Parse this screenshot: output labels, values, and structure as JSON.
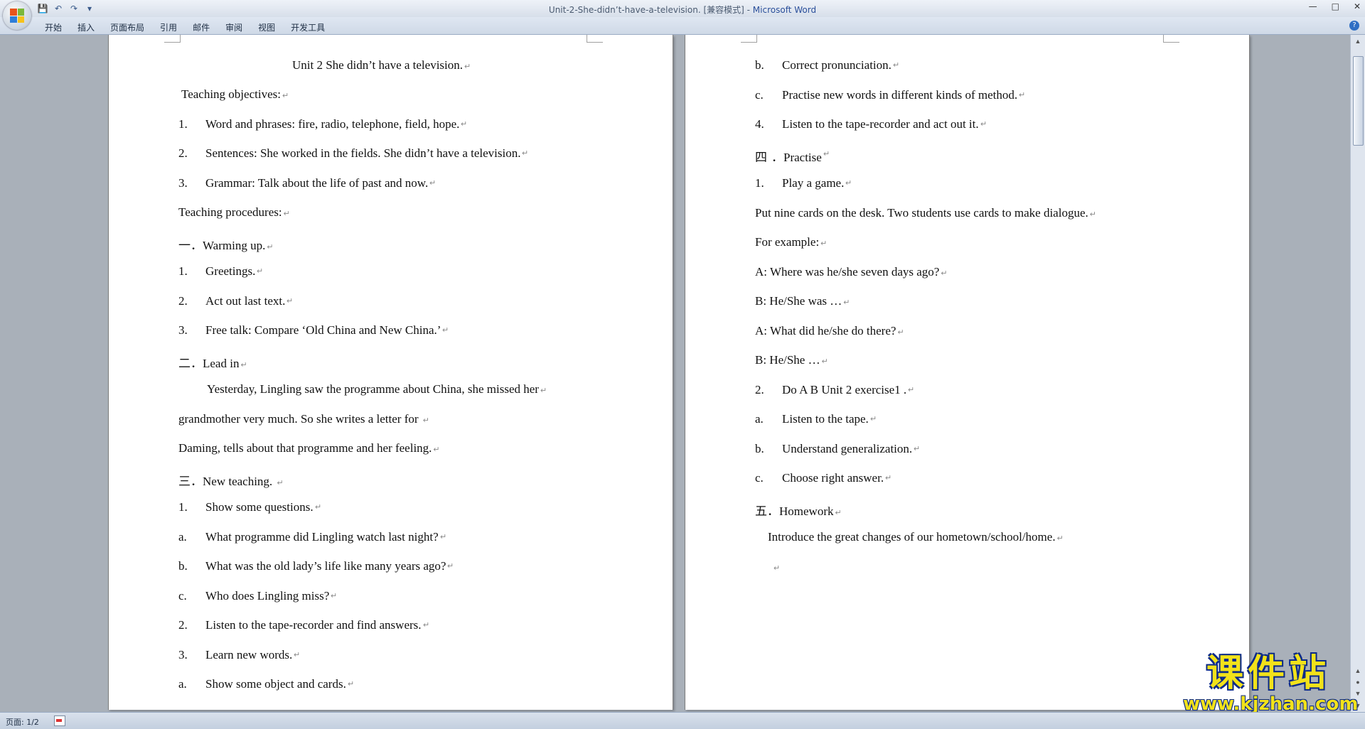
{
  "window": {
    "title": "Unit-2-She-didn’t-have-a-television. [兼容模式] - ",
    "app_name": "Microsoft Word",
    "controls": [
      "—",
      "□",
      "✕"
    ]
  },
  "quick_access": [
    "💾",
    "↶",
    "↷",
    "▾"
  ],
  "ribbon": {
    "tabs": [
      "开始",
      "插入",
      "页面布局",
      "引用",
      "邮件",
      "审阅",
      "视图",
      "开发工具"
    ],
    "help_icon": "?"
  },
  "document": {
    "left_page": {
      "title": "Unit 2 She didn’t have a television.",
      "lines": [
        {
          "text": "Teaching objectives:"
        },
        {
          "num": "1.",
          "text": "Word and phrases: fire, radio, telephone, field, hope."
        },
        {
          "num": "2.",
          "text": "Sentences: She worked in the fields. She didn’t have a television."
        },
        {
          "num": "3.",
          "text": "Grammar: Talk about the life of past and now."
        },
        {
          "text": "Teaching procedures:"
        },
        {
          "text": "一．Warming up."
        },
        {
          "num": "1.",
          "text": "Greetings."
        },
        {
          "num": "2.",
          "text": "Act out last text."
        },
        {
          "num": "3.",
          "text": "Free talk: Compare ‘Old China and New China.’"
        },
        {
          "text": "二．Lead in"
        },
        {
          "text": "Yesterday, Lingling saw the programme about China, she missed her"
        },
        {
          "text": "grandmother very much. So she writes a letter for  "
        },
        {
          "text": "Daming, tells about that programme and her feeling."
        },
        {
          "text": "三．New teaching.      "
        },
        {
          "num": "1.",
          "text": "Show some questions."
        },
        {
          "num": "a.",
          "text": "What programme did Lingling watch last night?"
        },
        {
          "num": "b.",
          "text": "What was the old lady’s life like many years ago?"
        },
        {
          "num": "c.",
          "text": "Who does Lingling miss?"
        },
        {
          "num": "2.",
          "text": "Listen to the tape-recorder and find answers."
        },
        {
          "num": "3.",
          "text": "Learn new words."
        },
        {
          "num": "a.",
          "text": "Show some object and cards."
        }
      ]
    },
    "right_page": {
      "lines": [
        {
          "num": "b.",
          "text": "Correct pronunciation."
        },
        {
          "num": "c.",
          "text": "Practise new words in different kinds of method."
        },
        {
          "num": "4.",
          "text": "Listen to the tape-recorder and act out it."
        },
        {
          "num": "四",
          "text": "．Practise"
        },
        {
          "num": "1.",
          "text": "Play a game."
        },
        {
          "text": "Put nine cards on the desk. Two students use cards to make dialogue."
        },
        {
          "text": "For example:"
        },
        {
          "text": "A: Where was he/she seven days ago?"
        },
        {
          "text": "B: He/She was …"
        },
        {
          "text": "A: What did he/she do there?"
        },
        {
          "text": "B: He/She …"
        },
        {
          "num": "2.",
          "text": "Do A B Unit 2 exercise1 ."
        },
        {
          "num": "a.",
          "text": "Listen to the tape."
        },
        {
          "num": "b.",
          "text": "Understand generalization."
        },
        {
          "num": "c.",
          "text": "Choose right answer."
        },
        {
          "text": "五．Homework"
        },
        {
          "text": "Introduce the great changes of our hometown/school/home."
        },
        {
          "text": ""
        }
      ]
    },
    "paragraph_mark": "↵"
  },
  "status_bar": {
    "page_label": "页面: 1/2"
  },
  "watermark": {
    "text": "课件站",
    "url": "www.kjzhan.com"
  }
}
